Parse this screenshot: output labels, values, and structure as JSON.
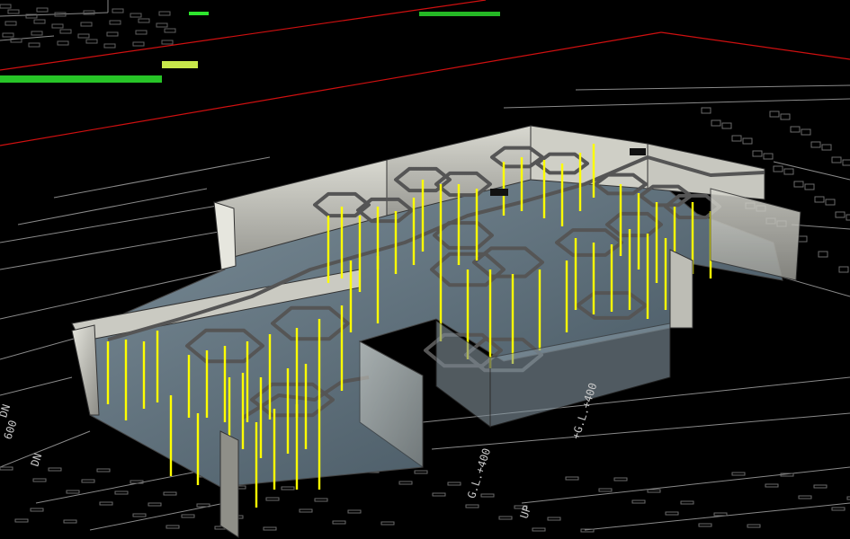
{
  "view": {
    "background": "#000000",
    "linework_color": "#9a9a9a",
    "boundary_color": "#d01010",
    "highlight_color": "#2ee62e",
    "column_color": "#ffff00",
    "beam_color": "#555555",
    "wall_color": "#b8b8ae",
    "floor_color": "#50606d"
  },
  "labels": {
    "dn_left": "DN",
    "dn_lower": "DN",
    "dim_600": "600",
    "level_mark": "G.L.+400",
    "up": "UP",
    "level_mark_right": "+G.L.+400"
  }
}
